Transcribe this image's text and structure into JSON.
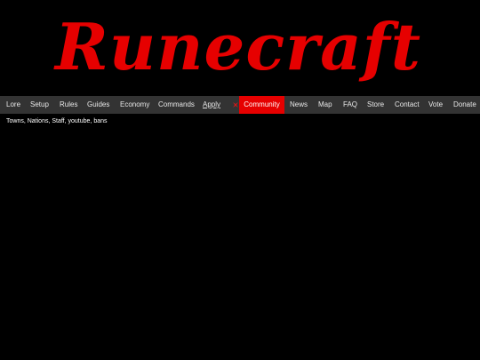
{
  "brand": {
    "name": "Runecraft",
    "color": "#e60000"
  },
  "nav": {
    "items": [
      {
        "label": "Lore"
      },
      {
        "label": "Setup"
      },
      {
        "label": "Rules"
      },
      {
        "label": "Guides"
      },
      {
        "label": "Economy"
      },
      {
        "label": "Commands"
      },
      {
        "label": "Apply"
      },
      {
        "label": "Community"
      },
      {
        "label": "News"
      },
      {
        "label": "Map"
      },
      {
        "label": "FAQ"
      },
      {
        "label": "Store"
      },
      {
        "label": "Contact"
      },
      {
        "label": "Vote"
      },
      {
        "label": "Donate"
      }
    ],
    "active": "Community",
    "active_color": "#e60000",
    "bar_color": "#333333",
    "icon": "minecraft-rune-icon"
  },
  "subnav": {
    "text": "Towns, Nations, Staff, youtube, bans"
  }
}
